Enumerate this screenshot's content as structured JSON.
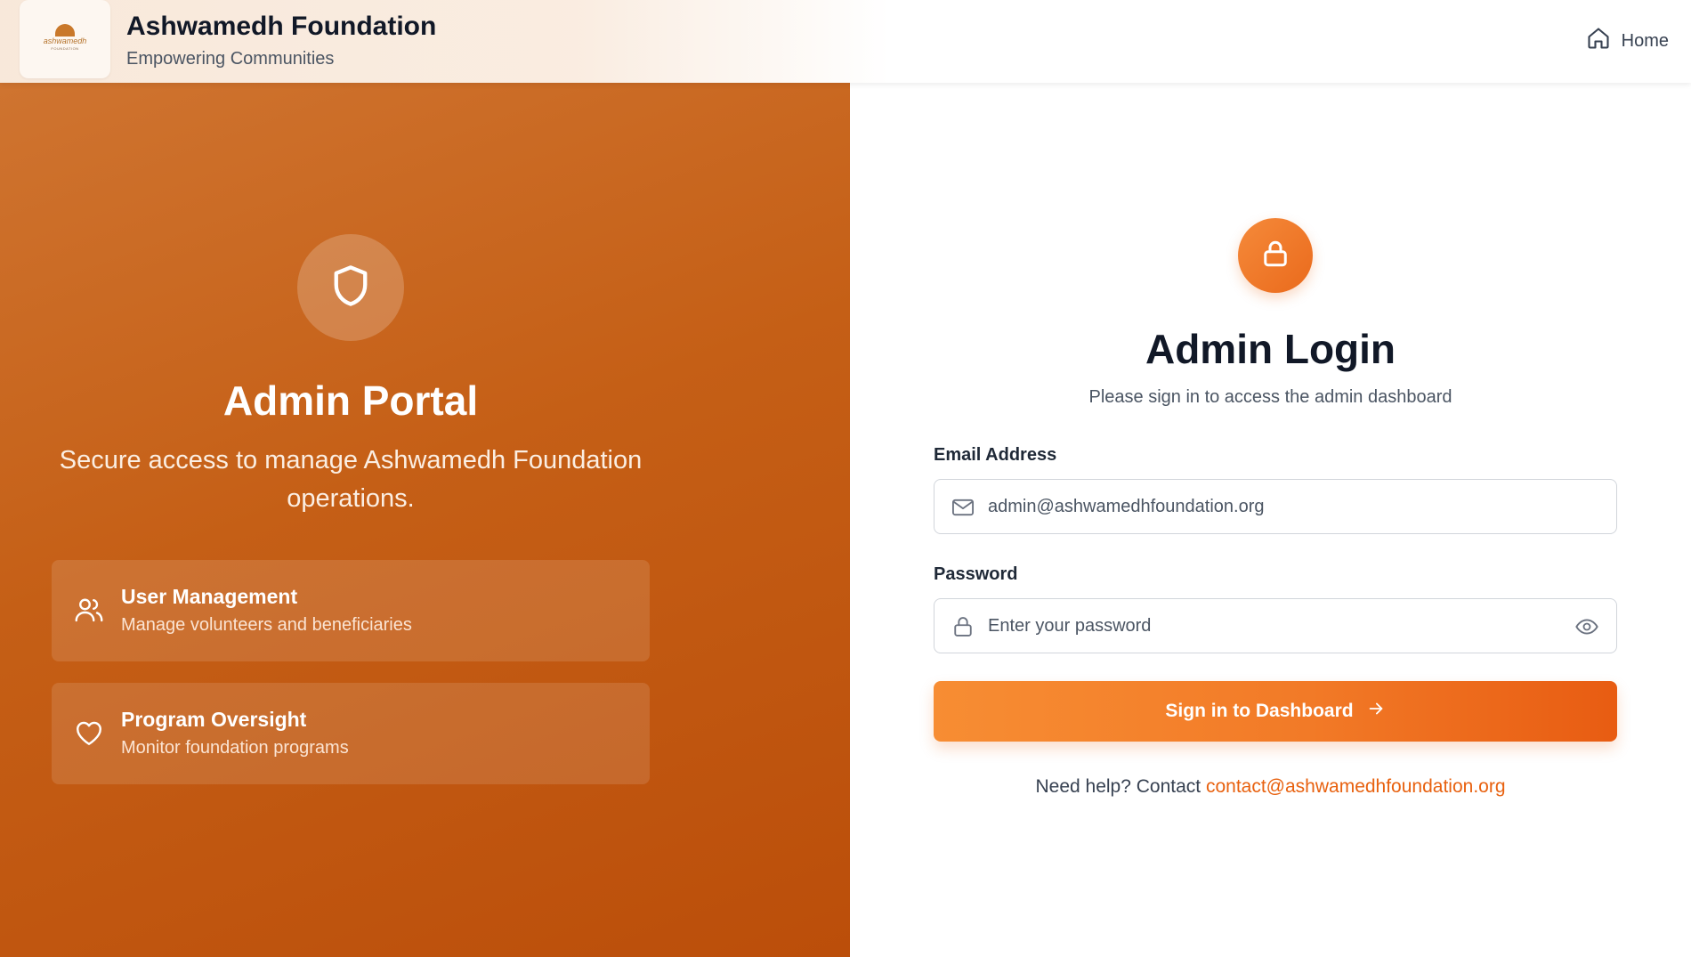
{
  "header": {
    "logo_text": "ashwamedh",
    "logo_subtext": "FOUNDATION",
    "title": "Ashwamedh Foundation",
    "subtitle": "Empowering Communities",
    "home_label": "Home"
  },
  "left": {
    "icon": "shield-icon",
    "title": "Admin Portal",
    "description": "Secure access to manage Ashwamedh Foundation operations.",
    "features": [
      {
        "icon": "users-icon",
        "title": "User Management",
        "description": "Manage volunteers and beneficiaries"
      },
      {
        "icon": "heart-icon",
        "title": "Program Oversight",
        "description": "Monitor foundation programs"
      }
    ]
  },
  "login": {
    "icon": "lock-icon",
    "title": "Admin Login",
    "subtitle": "Please sign in to access the admin dashboard",
    "email": {
      "label": "Email Address",
      "placeholder": "admin@ashwamedhfoundation.org",
      "value": ""
    },
    "password": {
      "label": "Password",
      "placeholder": "Enter your password",
      "value": ""
    },
    "submit_label": "Sign in to Dashboard",
    "help_text": "Need help? Contact",
    "help_email": "contact@ashwamedhfoundation.org"
  },
  "colors": {
    "accent": "#f27a27",
    "accent_dark": "#e85c12",
    "panel_start": "#cf7430",
    "panel_end": "#bb4e0a",
    "link": "#e8610f"
  }
}
